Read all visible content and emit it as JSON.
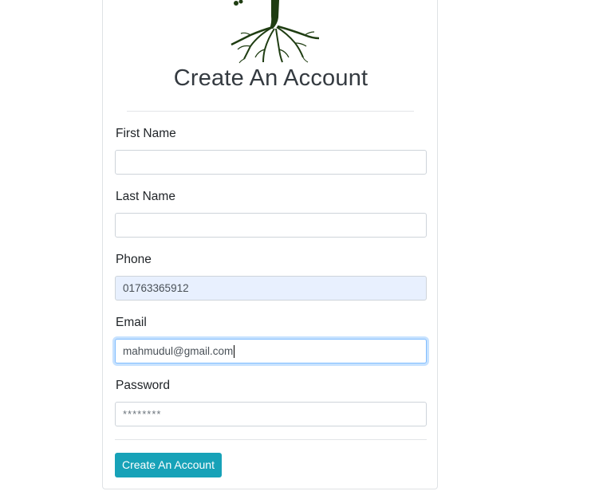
{
  "form": {
    "title": "Create An Account",
    "fields": [
      {
        "label": "First Name",
        "value": "",
        "type": "text"
      },
      {
        "label": "Last Name",
        "value": "",
        "type": "text"
      },
      {
        "label": "Phone",
        "value": "01763365912",
        "type": "text",
        "autofilled": true
      },
      {
        "label": "Email",
        "value": "mahmudul@gmail.com",
        "type": "email",
        "focused": true
      },
      {
        "label": "Password",
        "value": "********",
        "type": "password"
      }
    ],
    "submit_label": "Create An Account"
  },
  "colors": {
    "button": "#17a2b8",
    "autofill_bg": "#e8f0fe",
    "focus_border": "#80bdff",
    "logo_tree": "#1f3d12"
  },
  "logo": {
    "icon": "tree-roots-icon"
  }
}
